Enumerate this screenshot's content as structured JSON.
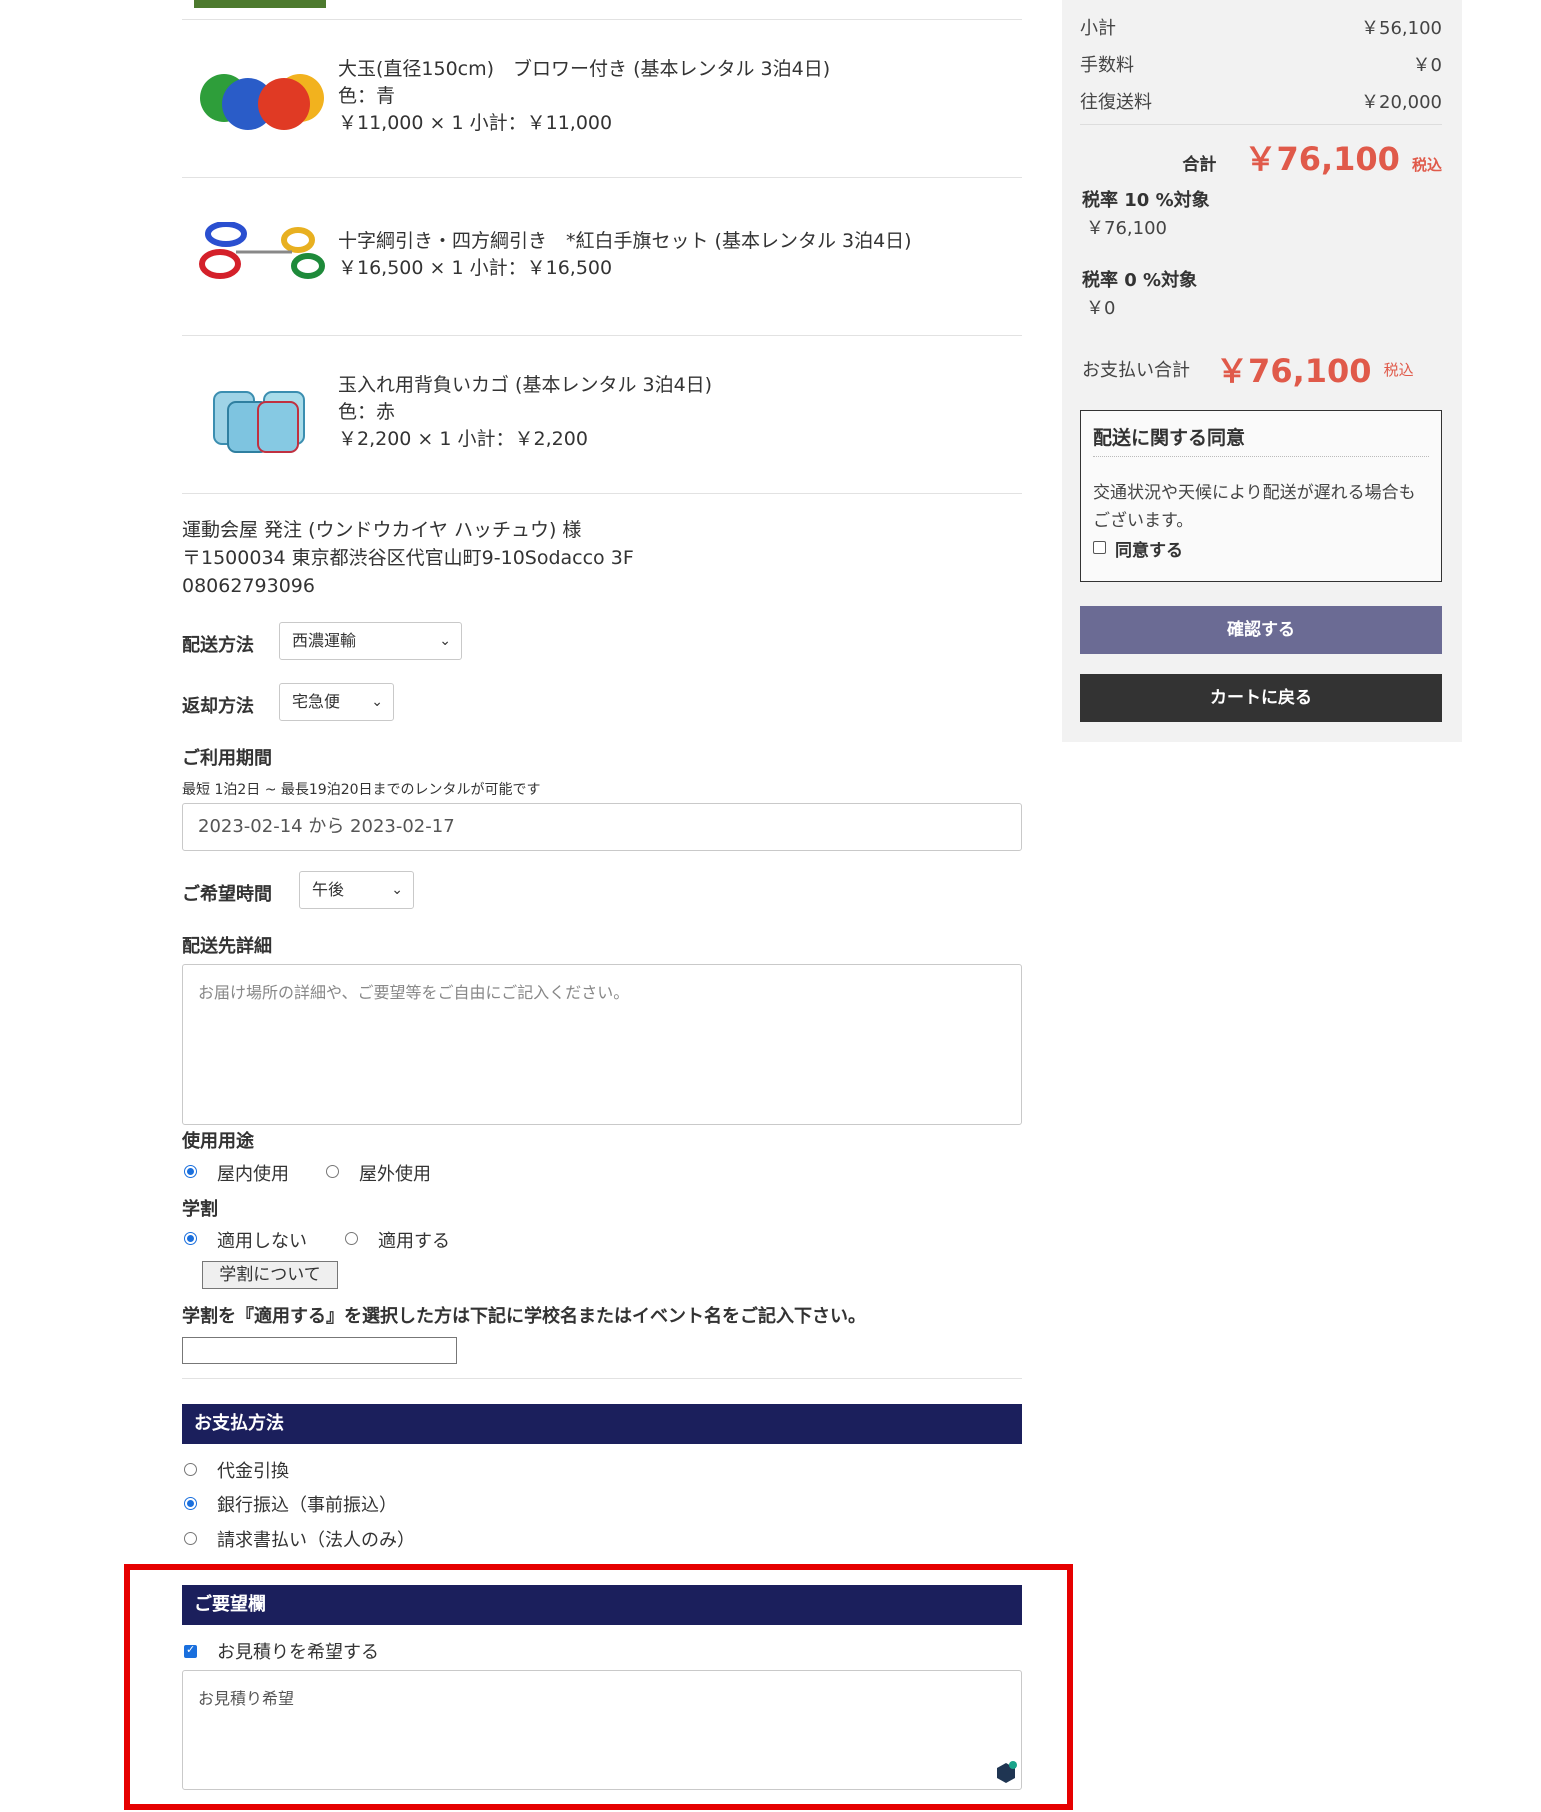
{
  "items": [
    {
      "name": "大玉(直径150cm)　ブロワー付き (基本レンタル 3泊4日)",
      "color": "色：青",
      "price": "￥11,000 × 1  小計：￥11,000"
    },
    {
      "name": "十字綱引き・四方綱引き　*紅白手旗セット (基本レンタル 3泊4日)",
      "price": "￥16,500 × 1  小計：￥16,500"
    },
    {
      "name": "玉入れ用背負いカゴ (基本レンタル 3泊4日)",
      "color": "色：赤",
      "price": "￥2,200 × 1  小計：￥2,200"
    }
  ],
  "address": {
    "name": "運動会屋 発注 (ウンドウカイヤ ハッチュウ) 様",
    "line": "〒1500034 東京都渋谷区代官山町9-10Sodacco 3F",
    "phone": "08062793096"
  },
  "form": {
    "shipping_label": "配送方法",
    "shipping_value": "西濃運輸",
    "return_label": "返却方法",
    "return_value": "宅急便",
    "period_label": "ご利用期間",
    "period_note": "最短 1泊2日 ~ 最長19泊20日までのレンタルが可能です",
    "period_value": "2023-02-14 から 2023-02-17",
    "time_label": "ご希望時間",
    "time_value": "午後",
    "detail_label": "配送先詳細",
    "detail_placeholder": "お届け場所の詳細や、ご要望等をご自由にご記入ください。",
    "usage_label": "使用用途",
    "usage_options": [
      "屋内使用",
      "屋外使用"
    ],
    "discount_label": "学割",
    "discount_options": [
      "適用しない",
      "適用する"
    ],
    "discount_button": "学割について",
    "school_note": "学割を『適用する』を選択した方は下記に学校名またはイベント名をご記入下さい。"
  },
  "payment": {
    "heading": "お支払方法",
    "options": [
      "代金引換",
      "銀行振込（事前振込）",
      "請求書払い（法人のみ）"
    ],
    "selected_index": 1
  },
  "request": {
    "heading": "ご要望欄",
    "checkbox_label": "お見積りを希望する",
    "checked": true,
    "text": "お見積り希望"
  },
  "summary": {
    "subtotal_label": "小計",
    "subtotal": "￥56,100",
    "fee_label": "手数料",
    "fee": "￥0",
    "shipping_label": "往復送料",
    "shipping": "￥20,000",
    "total_label": "合計",
    "total": "￥76,100",
    "tax_incl": "税込",
    "tax10_label": "税率 10 %対象",
    "tax10_value": "￥76,100",
    "tax0_label": "税率 0 %対象",
    "tax0_value": "￥0",
    "pay_total_label": "お支払い合計",
    "pay_total": "￥76,100",
    "pay_tax_incl": "税込"
  },
  "consent": {
    "title": "配送に関する同意",
    "text": "交通状況や天候により配送が遅れる場合もございます。",
    "agree": "同意する"
  },
  "buttons": {
    "confirm": "確認する",
    "back_to_cart": "カートに戻る"
  },
  "colors": {
    "accent_red": "#e05a4a",
    "section_navy": "#1b1f5c",
    "confirm_purple": "#6b6b94",
    "highlight_frame": "#e60000"
  }
}
